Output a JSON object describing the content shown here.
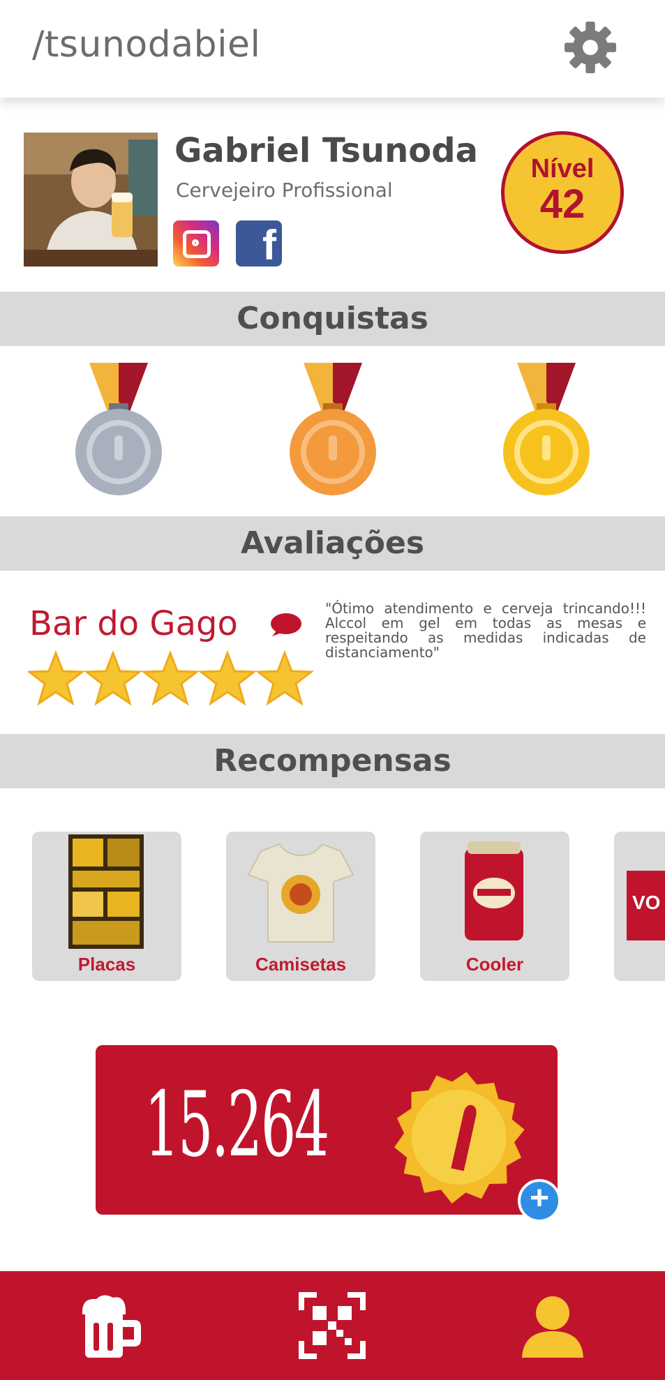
{
  "header": {
    "username": "/tsunodabiel",
    "settings_icon": "gear-icon"
  },
  "profile": {
    "name": "Gabriel Tsunoda",
    "title": "Cervejeiro Profissional",
    "level_label": "Nível",
    "level_value": "42",
    "social": [
      "instagram-icon",
      "facebook-icon"
    ]
  },
  "sections": {
    "achievements": "Conquistas",
    "reviews": "Avaliações",
    "rewards": "Recompensas"
  },
  "achievements": [
    {
      "name": "silver-medal",
      "color": "#a9b0bd"
    },
    {
      "name": "bronze-medal",
      "color": "#f39a3d"
    },
    {
      "name": "gold-medal",
      "color": "#f8c21e"
    }
  ],
  "review": {
    "place": "Bar do Gago",
    "stars": 5,
    "text": "\"Ótimo atendimento e cerveja trincando!!! Alccol em gel em todas as mesas e respeitando as medidas indicadas de distanciamento\""
  },
  "rewards": [
    {
      "label": "Placas"
    },
    {
      "label": "Camisetas"
    },
    {
      "label": "Cooler"
    },
    {
      "label": "VO"
    }
  ],
  "balance": {
    "value": "15.264"
  },
  "nav": [
    "beer-mug-icon",
    "qr-scan-icon",
    "user-icon"
  ],
  "colors": {
    "brand_red": "#c0142c",
    "gold": "#f6c431",
    "section_gray": "#d9d9d9"
  }
}
